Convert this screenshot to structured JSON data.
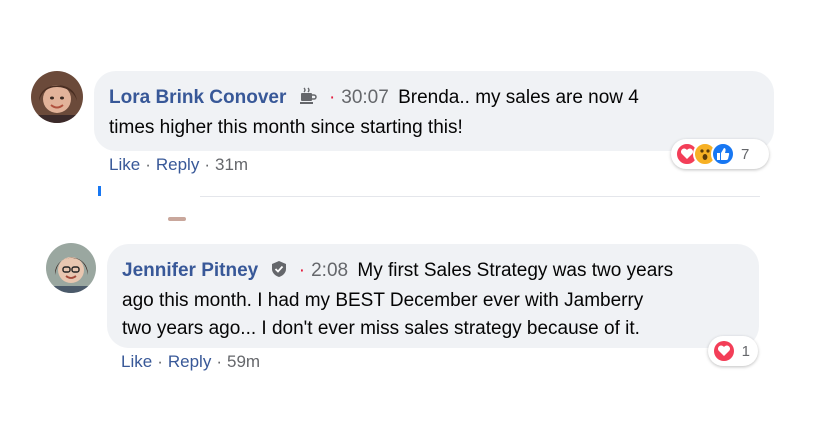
{
  "comments": [
    {
      "author": "Lora Brink Conover",
      "author_icon": "coffee-cup-icon",
      "dot": "·",
      "timestamp": "30:07",
      "text_line1": "Brenda.. my sales are now 4",
      "text_line2": "times higher this month since starting this!",
      "actions": {
        "like": "Like",
        "reply": "Reply",
        "age": "31m",
        "sep": "·"
      },
      "reactions": {
        "icons": [
          "love-icon",
          "wow-icon",
          "like-icon"
        ],
        "count": "7"
      }
    },
    {
      "author": "Jennifer Pitney",
      "author_icon": "verified-shield-icon",
      "dot": "·",
      "timestamp": "2:08",
      "text_line1": "My first Sales Strategy was two years",
      "text_line2": "ago this month. I had my BEST December ever with Jamberry",
      "text_line3": "two years ago... I don't ever miss sales strategy because of it.",
      "actions": {
        "like": "Like",
        "reply": "Reply",
        "age": "59m",
        "sep": "·"
      },
      "reactions": {
        "icons": [
          "love-icon"
        ],
        "count": "1"
      }
    }
  ],
  "colors": {
    "author": "#385898",
    "bubble": "#f0f2f5",
    "love": "#f33e58",
    "wow": "#f7b125",
    "like": "#1877f2"
  }
}
